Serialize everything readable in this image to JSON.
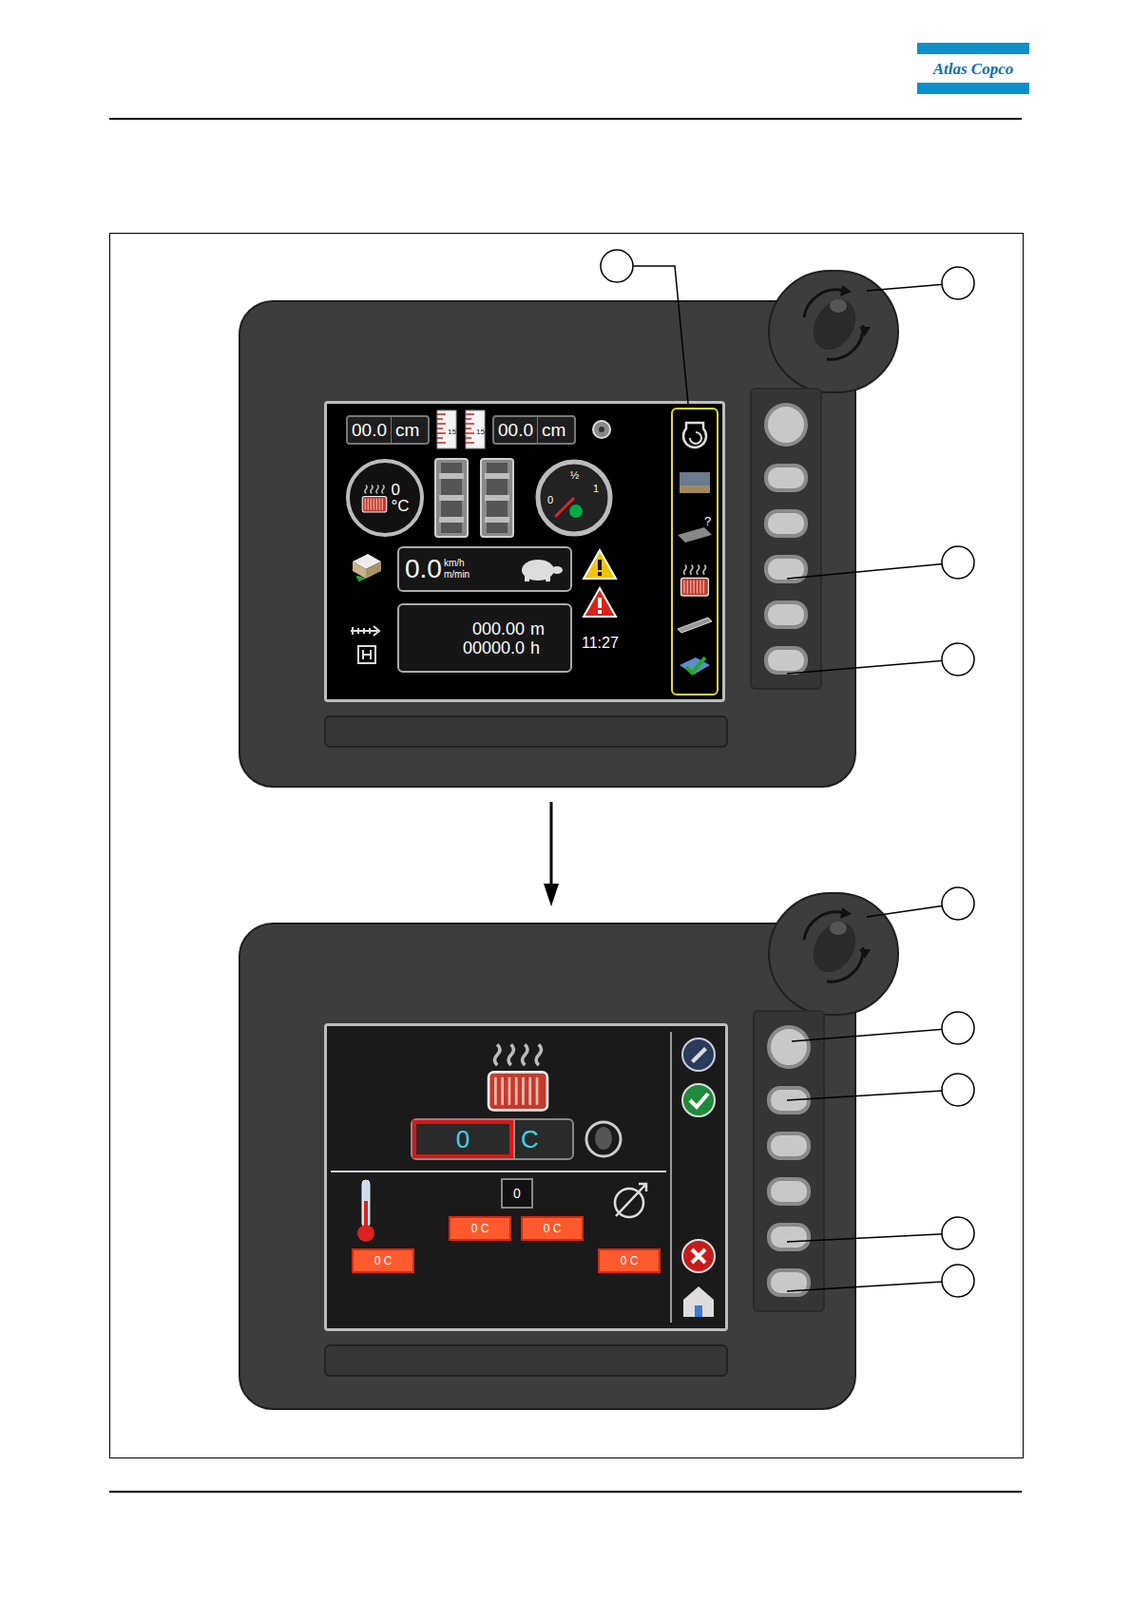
{
  "logo": {
    "text": "Atlas Copco"
  },
  "screen_main": {
    "thickness_left": {
      "value": "00.0",
      "unit": "cm"
    },
    "thickness_right": {
      "value": "00.0",
      "unit": "cm"
    },
    "ruler_label": "15",
    "heater_gauge": {
      "value": "0",
      "unit": "°C"
    },
    "fuel_gauge": {
      "labels": [
        "0",
        "½",
        "1"
      ],
      "level": 0
    },
    "speed": {
      "value": "0.0",
      "units": [
        "km/h",
        "m/min"
      ]
    },
    "distance": {
      "value": "000.00",
      "unit": "m"
    },
    "hours": {
      "value": "00000.0",
      "unit": "h"
    },
    "clock": "11:27"
  },
  "screen_heating": {
    "setpoint": {
      "value": "0",
      "unit": "C",
      "focused": true
    },
    "count": "0",
    "readings": [
      "0 C",
      "0 C",
      "0 C",
      "0 C"
    ]
  }
}
